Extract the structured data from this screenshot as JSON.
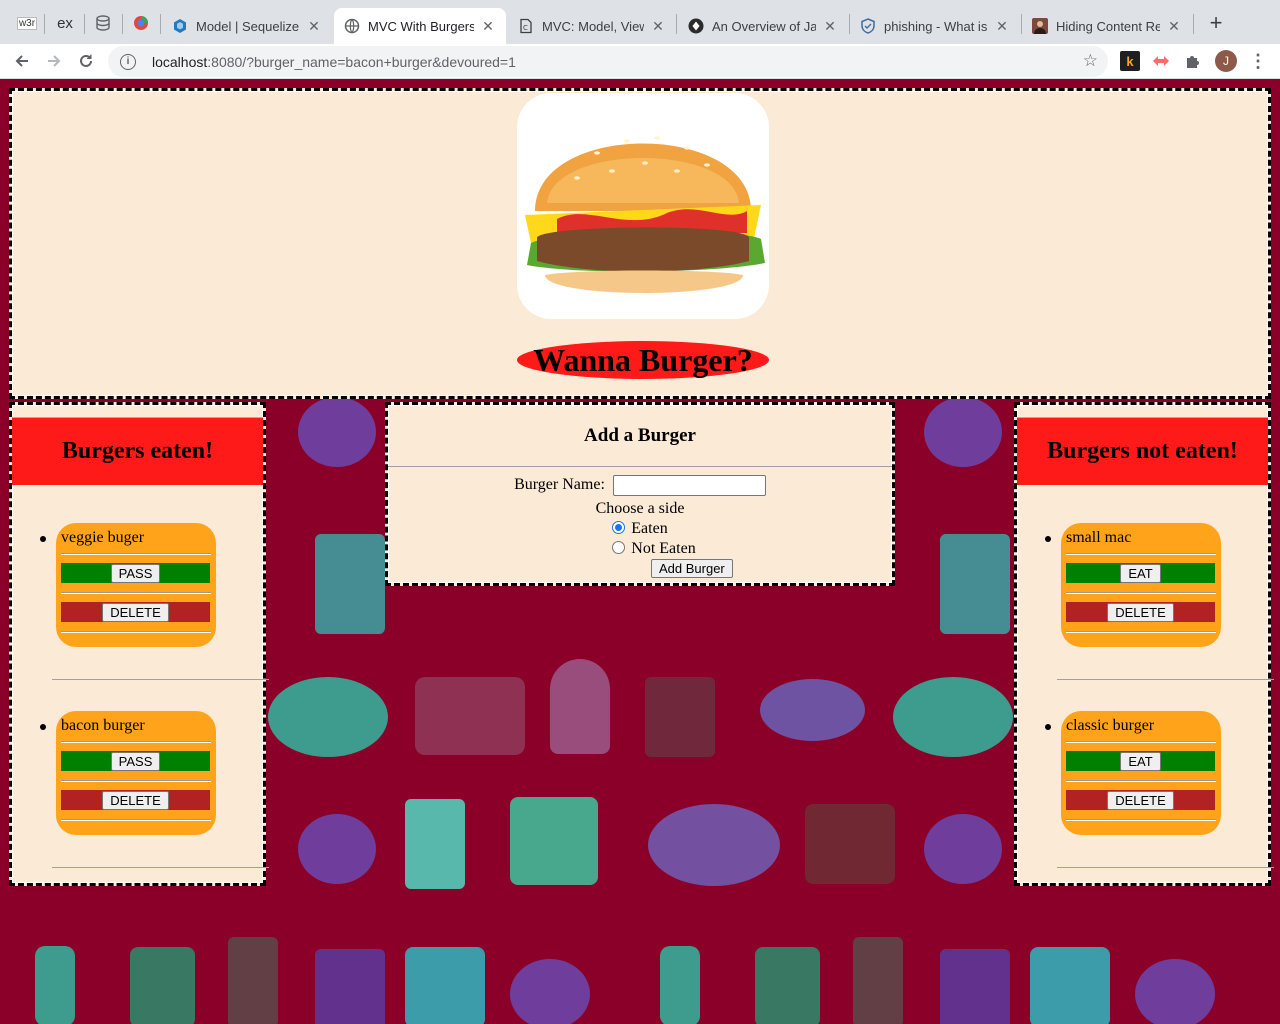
{
  "browser": {
    "pinned_tabs": [
      {
        "icon": "w3schools-icon",
        "text": "w3r"
      },
      {
        "icon": "express-icon",
        "text": "ex"
      },
      {
        "icon": "database-icon",
        "text": ""
      },
      {
        "icon": "sequelize-app-icon",
        "text": ""
      }
    ],
    "tabs": [
      {
        "title": "Model | Sequelize",
        "icon": "sequelize-icon",
        "active": false
      },
      {
        "title": "MVC With Burgers!",
        "icon": "globe-icon",
        "active": true
      },
      {
        "title": "MVC: Model, View,",
        "icon": "document-icon",
        "active": false
      },
      {
        "title": "An Overview of Jav",
        "icon": "gear-icon",
        "active": false
      },
      {
        "title": "phishing - What is",
        "icon": "shield-icon",
        "active": false
      },
      {
        "title": "Hiding Content Res",
        "icon": "avatar-icon",
        "active": false
      }
    ],
    "url_host": "localhost",
    "url_rest": ":8080/?burger_name=bacon+burger&devoured=1",
    "profile_initial": "J",
    "ext_k": "k"
  },
  "page": {
    "title": "Wanna Burger?",
    "left_panel": {
      "heading": "Burgers eaten!",
      "burgers": [
        {
          "name": "veggie buger",
          "action": "PASS",
          "delete": "DELETE"
        },
        {
          "name": "bacon burger",
          "action": "PASS",
          "delete": "DELETE"
        }
      ]
    },
    "right_panel": {
      "heading": "Burgers not eaten!",
      "burgers": [
        {
          "name": "small mac",
          "action": "EAT",
          "delete": "DELETE"
        },
        {
          "name": "classic burger",
          "action": "EAT",
          "delete": "DELETE"
        }
      ]
    },
    "form": {
      "title": "Add a Burger",
      "name_label": "Burger Name:",
      "name_value": "",
      "side_label": "Choose a side",
      "option_eaten": "Eaten",
      "option_not_eaten": "Not Eaten",
      "selected": "Eaten",
      "submit": "Add Burger"
    }
  },
  "colors": {
    "background": "#8a0029",
    "panel": "#fbead6",
    "header_red": "#ff1a1a",
    "card_orange": "#ffa31a",
    "eat_green": "#008000",
    "delete_red": "#b22222"
  }
}
